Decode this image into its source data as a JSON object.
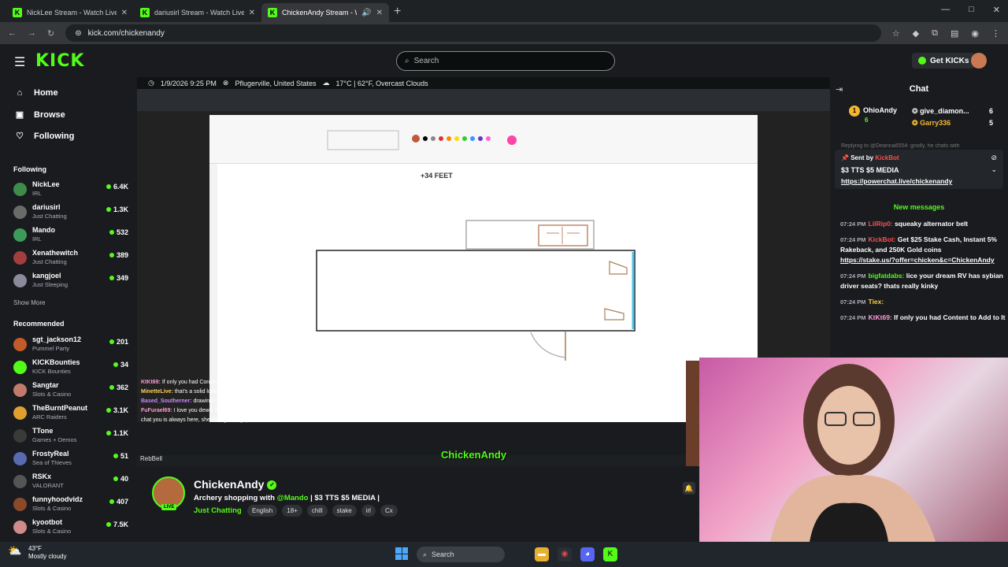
{
  "browser": {
    "tabs": [
      {
        "label": "NickLee Stream - Watch Live o",
        "active": false
      },
      {
        "label": "dariusirl Stream - Watch Live o",
        "active": false
      },
      {
        "label": "ChickenAndy Stream - Watc",
        "active": true
      }
    ],
    "url": "kick.com/chickenandy",
    "window_controls": [
      "—",
      "□",
      "✕"
    ]
  },
  "header": {
    "logo": "KICK",
    "search_placeholder": "Search",
    "get_kicks_label": "Get KICKs"
  },
  "sidebar": {
    "nav": [
      {
        "icon": "home-icon",
        "glyph": "⌂",
        "label": "Home"
      },
      {
        "icon": "compass-icon",
        "glyph": "▣",
        "label": "Browse"
      },
      {
        "icon": "heart-icon",
        "glyph": "♡",
        "label": "Following"
      }
    ],
    "following_title": "Following",
    "following": [
      {
        "name": "NickLee",
        "category": "IRL",
        "viewers": "6.4K",
        "color": "#3e8b4a"
      },
      {
        "name": "dariusirl",
        "category": "Just Chatting",
        "viewers": "1.3K",
        "color": "#6a6a6a"
      },
      {
        "name": "Mando",
        "category": "IRL",
        "viewers": "532",
        "color": "#3c9b5a"
      },
      {
        "name": "Xenathewitch",
        "category": "Just Chatting",
        "viewers": "389",
        "color": "#a23e3e"
      },
      {
        "name": "kangjoel",
        "category": "Just Sleeping",
        "viewers": "349",
        "color": "#8a8a9a"
      }
    ],
    "show_more": "Show More",
    "recommended_title": "Recommended",
    "recommended": [
      {
        "name": "sgt_jackson12",
        "category": "Pummel Party",
        "viewers": "201",
        "color": "#c45a2a"
      },
      {
        "name": "KICKBounties",
        "category": "KICK Bounties",
        "viewers": "34",
        "color": "#53fc18"
      },
      {
        "name": "Sangtar",
        "category": "Slots & Casino",
        "viewers": "362",
        "color": "#c27a6a"
      },
      {
        "name": "TheBurntPeanut",
        "category": "ARC Raiders",
        "viewers": "3.1K",
        "color": "#e0a030"
      },
      {
        "name": "TTone",
        "category": "Games + Demos",
        "viewers": "1.1K",
        "color": "#3a3a3a"
      },
      {
        "name": "FrostyReal",
        "category": "Sea of Thieves",
        "viewers": "51",
        "color": "#5a6ab0"
      },
      {
        "name": "RSKx",
        "category": "VALORANT",
        "viewers": "40",
        "color": "#555"
      },
      {
        "name": "funnyhoodvidz",
        "category": "Slots & Casino",
        "viewers": "407",
        "color": "#8a4a2a"
      },
      {
        "name": "kyootbot",
        "category": "Slots & Casino",
        "viewers": "7.5K",
        "color": "#d08a8a"
      }
    ]
  },
  "video": {
    "overlay_date": "1/9/2026 9:25 PM",
    "overlay_location": "Pflugerville, United States",
    "overlay_weather": "17°C | 62°F, Overcast Clouds",
    "drawing_label": "+34 FEET",
    "watermark": "ChickenAndy",
    "overlay_chat": [
      {
        "user": "KtKt69:",
        "text": "If only you had Content to Add to it",
        "color": "#ff9ad5"
      },
      {
        "user": "MinetteLive:",
        "text": "that's a solid looking ponte",
        "color": "#ffd05a"
      },
      {
        "user": "Based_Southerner:",
        "text": "drawing imaginary rvs now. yikes",
        "color": "#c98aff"
      },
      {
        "user": "FuFurael69:",
        "text": "I love you dewd. No matter when I pop up in chicken's chat you is always here, shenaningansing ;)",
        "color": "#ff9ad5"
      }
    ],
    "rebel_text": "RebBell"
  },
  "channel": {
    "name": "ChickenAndy",
    "live_label": "LIVE",
    "title_prefix": "Archery shopping with ",
    "title_mention": "@Mando",
    "title_suffix": " | $3 TTS $5 MEDIA |",
    "category": "Just Chatting",
    "tags": [
      "English",
      "18+",
      "chill",
      "stake",
      "irl",
      "Cx"
    ]
  },
  "chat": {
    "title": "Chat",
    "gifters": [
      {
        "rank": "1",
        "name": "OhioAndy",
        "count": "6"
      },
      {
        "name": "give_diamon...",
        "count": "6"
      },
      {
        "name": "Garry336",
        "count": "5"
      }
    ],
    "replying_text": "Replying to @Deanna6554: gnolly, he chats with",
    "pinned": {
      "sent_by_label": "Sent by",
      "sent_by_user": "KickBot",
      "message": "$3 TTS $5 MEDIA",
      "link": "https://powerchat.live/chickenandy"
    },
    "new_messages_label": "New messages",
    "messages": [
      {
        "time": "07:24 PM",
        "user": "LilRip0:",
        "user_class": "u-red",
        "text": "squeaky alternator belt",
        "link": ""
      },
      {
        "time": "07:24 PM",
        "user": "KickBot:",
        "user_class": "u-red",
        "text": "Get $25 Stake Cash, Instant 5% Rakeback, and 250K Gold coins",
        "link": "https://stake.us/?offer=chicken&c=ChickenAndy"
      },
      {
        "time": "07:24 PM",
        "user": "bigfatdabs:",
        "user_class": "u-green",
        "text": "lice your dream RV has sybian driver seats? thats really kinky",
        "link": ""
      },
      {
        "time": "07:24 PM",
        "user": "Tiex:",
        "user_class": "u-yel",
        "text": "",
        "link": ""
      },
      {
        "time": "07:24 PM",
        "user": "KtKt69:",
        "user_class": "u-pink",
        "text": "If only you had Content to Add to It",
        "link": ""
      }
    ]
  },
  "taskbar": {
    "temp": "43°F",
    "condition": "Mostly cloudy",
    "search_label": "Search"
  }
}
